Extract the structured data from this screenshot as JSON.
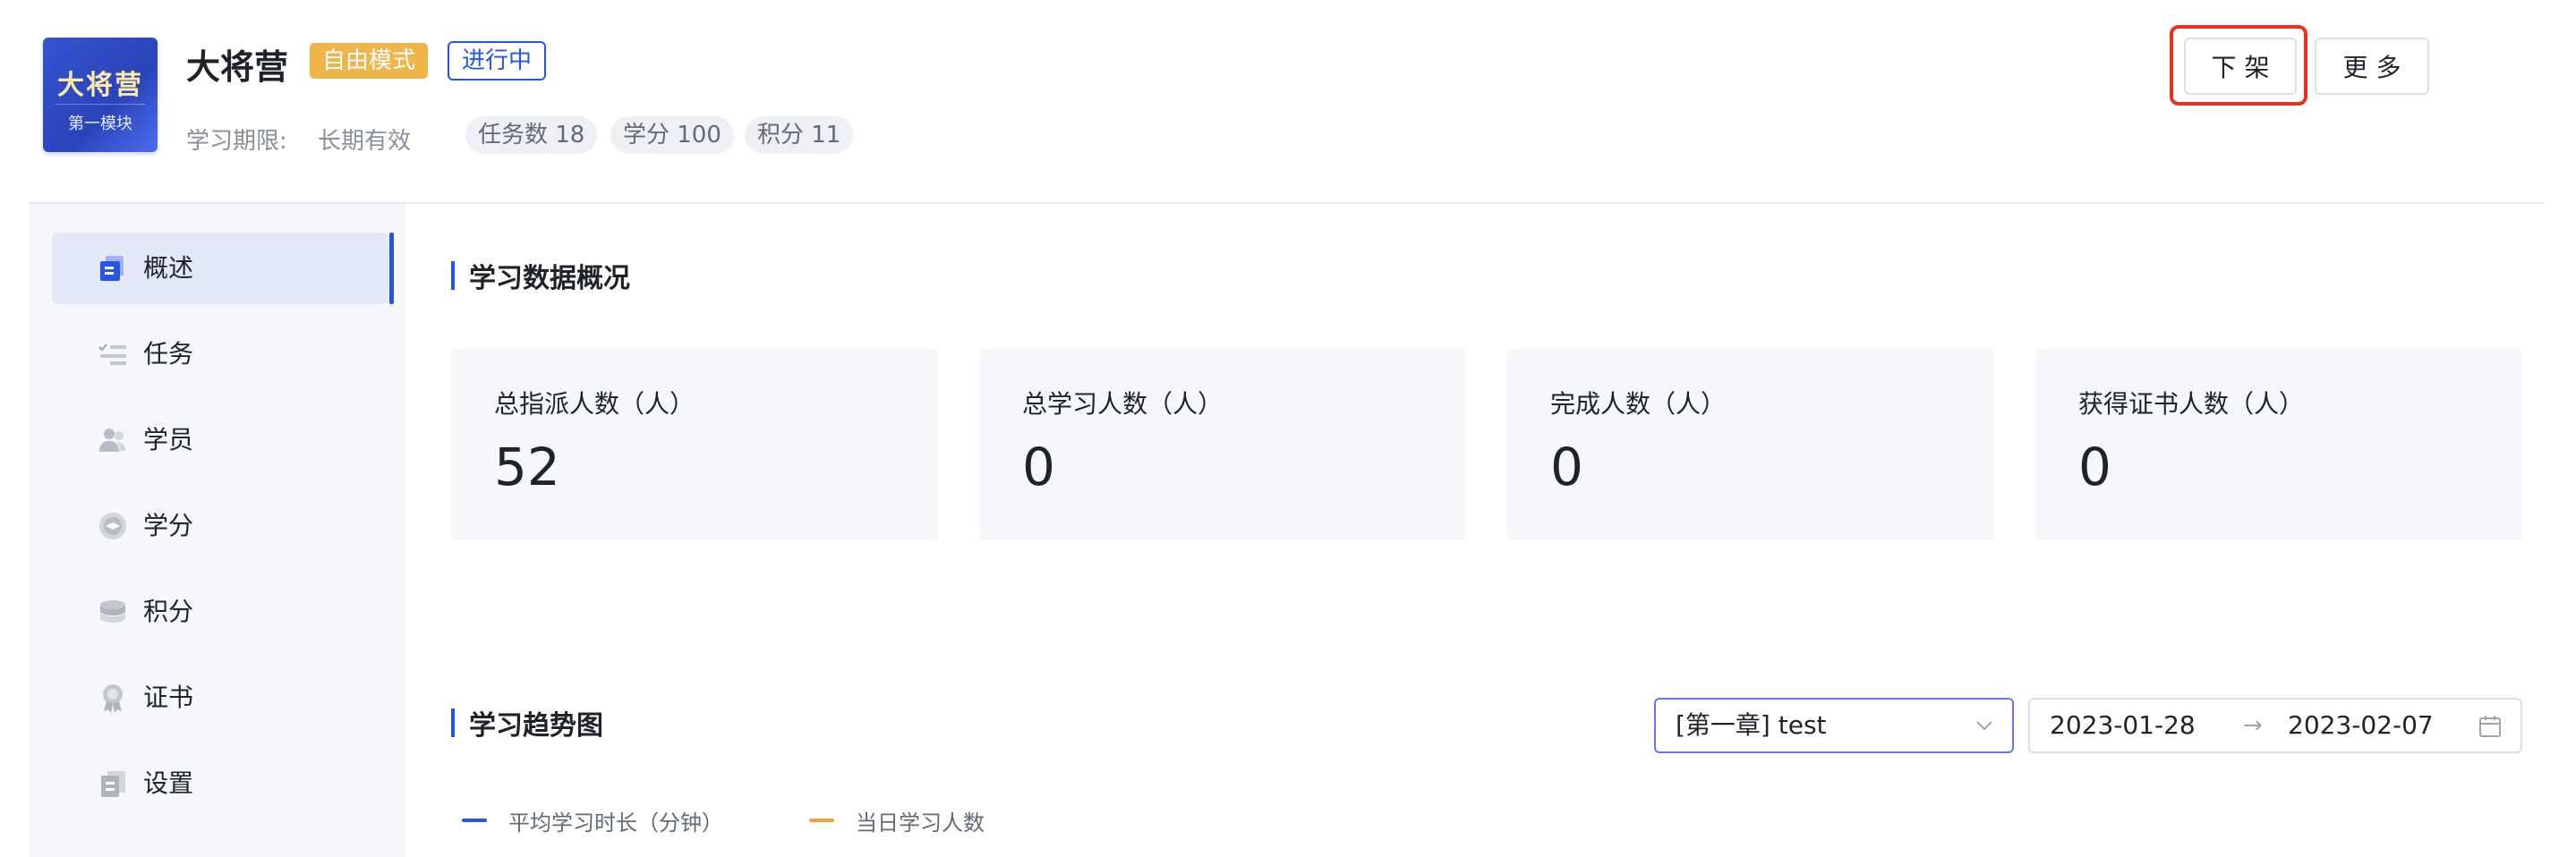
{
  "course": {
    "cover_title": "大将营",
    "cover_subtitle": "第一模块",
    "title": "大将营",
    "mode_tag": "自由模式",
    "status_tag": "进行中",
    "period_label": "学习期限:",
    "period_value": "长期有效",
    "pills": [
      "任务数 18",
      "学分 100",
      "积分 11"
    ]
  },
  "actions": {
    "offline_label": "下 架",
    "more_label": "更 多"
  },
  "sidebar": {
    "items": [
      {
        "label": "概述",
        "icon": "overview-icon",
        "active": true
      },
      {
        "label": "任务",
        "icon": "task-list-icon"
      },
      {
        "label": "学员",
        "icon": "users-icon"
      },
      {
        "label": "学分",
        "icon": "credit-icon"
      },
      {
        "label": "积分",
        "icon": "points-icon"
      },
      {
        "label": "证书",
        "icon": "certificate-icon"
      },
      {
        "label": "设置",
        "icon": "settings-icon"
      }
    ]
  },
  "overview": {
    "section_title": "学习数据概况",
    "stats": [
      {
        "label": "总指派人数（人）",
        "value": "52"
      },
      {
        "label": "总学习人数（人）",
        "value": "0"
      },
      {
        "label": "完成人数（人）",
        "value": "0"
      },
      {
        "label": "获得证书人数（人）",
        "value": "0"
      }
    ]
  },
  "trend": {
    "section_title": "学习趋势图",
    "chapter_select": "[第一章] test",
    "date_start": "2023-01-28",
    "date_arrow": "→",
    "date_end": "2023-02-07",
    "legend": [
      {
        "label": "平均学习时长（分钟）",
        "color": "#2454e8"
      },
      {
        "label": "当日学习人数",
        "color": "#f0a13a"
      }
    ]
  },
  "colors": {
    "accent": "#2454e8",
    "mode_tag_bg": "#f0b54a",
    "highlight": "#e8321f"
  }
}
